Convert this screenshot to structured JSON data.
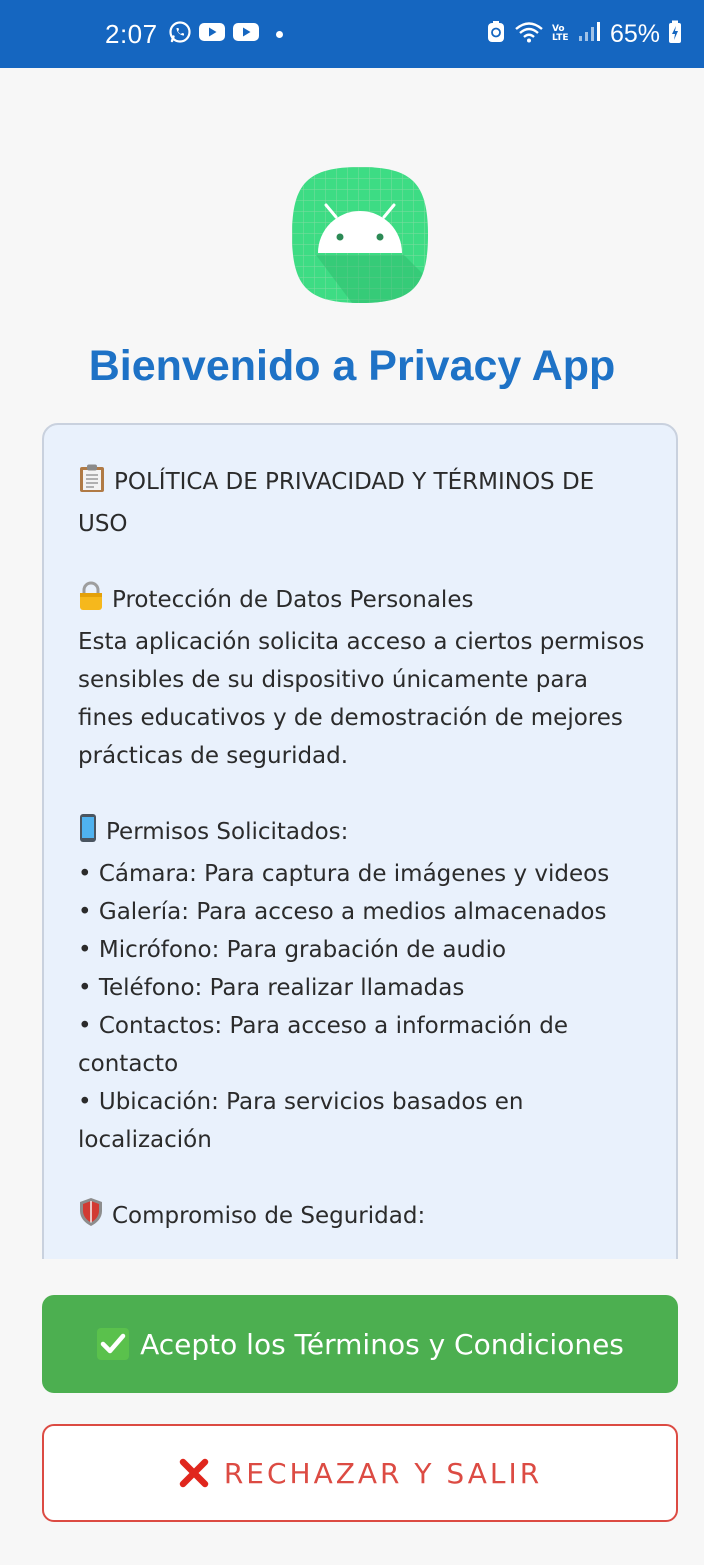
{
  "status_bar": {
    "time": "2:07",
    "battery": "65%",
    "icons": [
      "whatsapp-icon",
      "youtube-icon",
      "youtube-icon",
      "notification-dot-icon",
      "sync-icon",
      "wifi-icon",
      "volte-icon",
      "signal-icon",
      "battery-icon"
    ],
    "volte_label": "Vo LTE"
  },
  "header": {
    "title": "Bienvenido a Privacy App"
  },
  "policy": {
    "heading": "POLÍTICA DE PRIVACIDAD Y TÉRMINOS DE USO",
    "heading_icon": "clipboard-icon",
    "section1_title": "Protección de Datos Personales",
    "section1_icon": "lock-icon",
    "section1_body": "Esta aplicación solicita acceso a ciertos permisos sensibles de su dispositivo únicamente para fines educativos y de demostración de mejores prácticas de seguridad.",
    "section2_title": "Permisos Solicitados:",
    "section2_icon": "phone-icon",
    "permissions": [
      "• Cámara: Para captura de imágenes y videos",
      "• Galería: Para acceso a medios almacenados",
      "• Micrófono: Para grabación de audio",
      "• Teléfono: Para realizar llamadas",
      "• Contactos: Para acceso a información de contacto",
      "• Ubicación: Para servicios basados en localización"
    ],
    "section3_title": "Compromiso de Seguridad:",
    "section3_icon": "shield-icon"
  },
  "actions": {
    "accept_label": "Acepto los Términos y Condiciones",
    "accept_icon": "check-mark-icon",
    "reject_label": "RECHAZAR Y SALIR",
    "reject_icon": "cross-mark-icon"
  },
  "colors": {
    "status_bar": "#1566c0",
    "title": "#1e72c6",
    "accept": "#4caf50",
    "reject": "#dc4b43",
    "card_bg": "#e9f1fc"
  }
}
